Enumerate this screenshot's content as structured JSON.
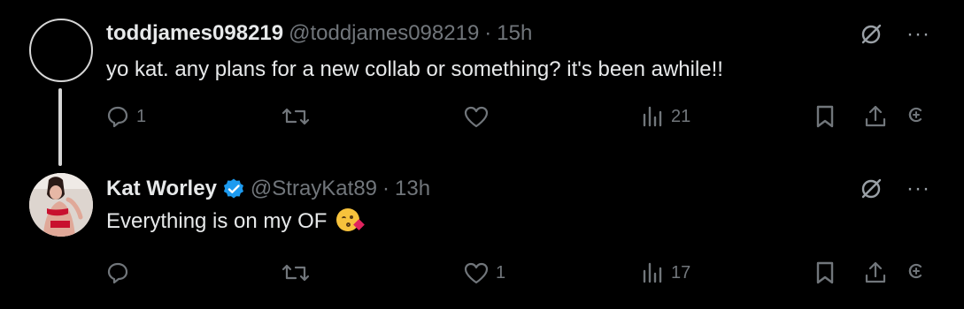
{
  "tweets": [
    {
      "display_name": "toddjames098219",
      "handle": "@toddjames098219",
      "separator": "·",
      "time": "15h",
      "text": "yo kat. any plans for a new collab or something? it's been awhile!!",
      "verified": false,
      "reply_count": "1",
      "retweet_count": "",
      "like_count": "",
      "view_count": "21"
    },
    {
      "display_name": "Kat Worley",
      "handle": "@StrayKat89",
      "separator": "·",
      "time": "13h",
      "text": "Everything is on my OF",
      "verified": true,
      "reply_count": "",
      "retweet_count": "",
      "like_count": "1",
      "view_count": "17"
    }
  ],
  "colors": {
    "background": "#000000",
    "text_primary": "#e7e9ea",
    "text_secondary": "#71767b",
    "verified_blue": "#1d9bf0"
  },
  "icons": [
    "reply-icon",
    "retweet-icon",
    "like-icon",
    "views-icon",
    "bookmark-icon",
    "share-icon",
    "grok-icon",
    "mute-icon",
    "more-icon",
    "verified-badge-icon"
  ]
}
